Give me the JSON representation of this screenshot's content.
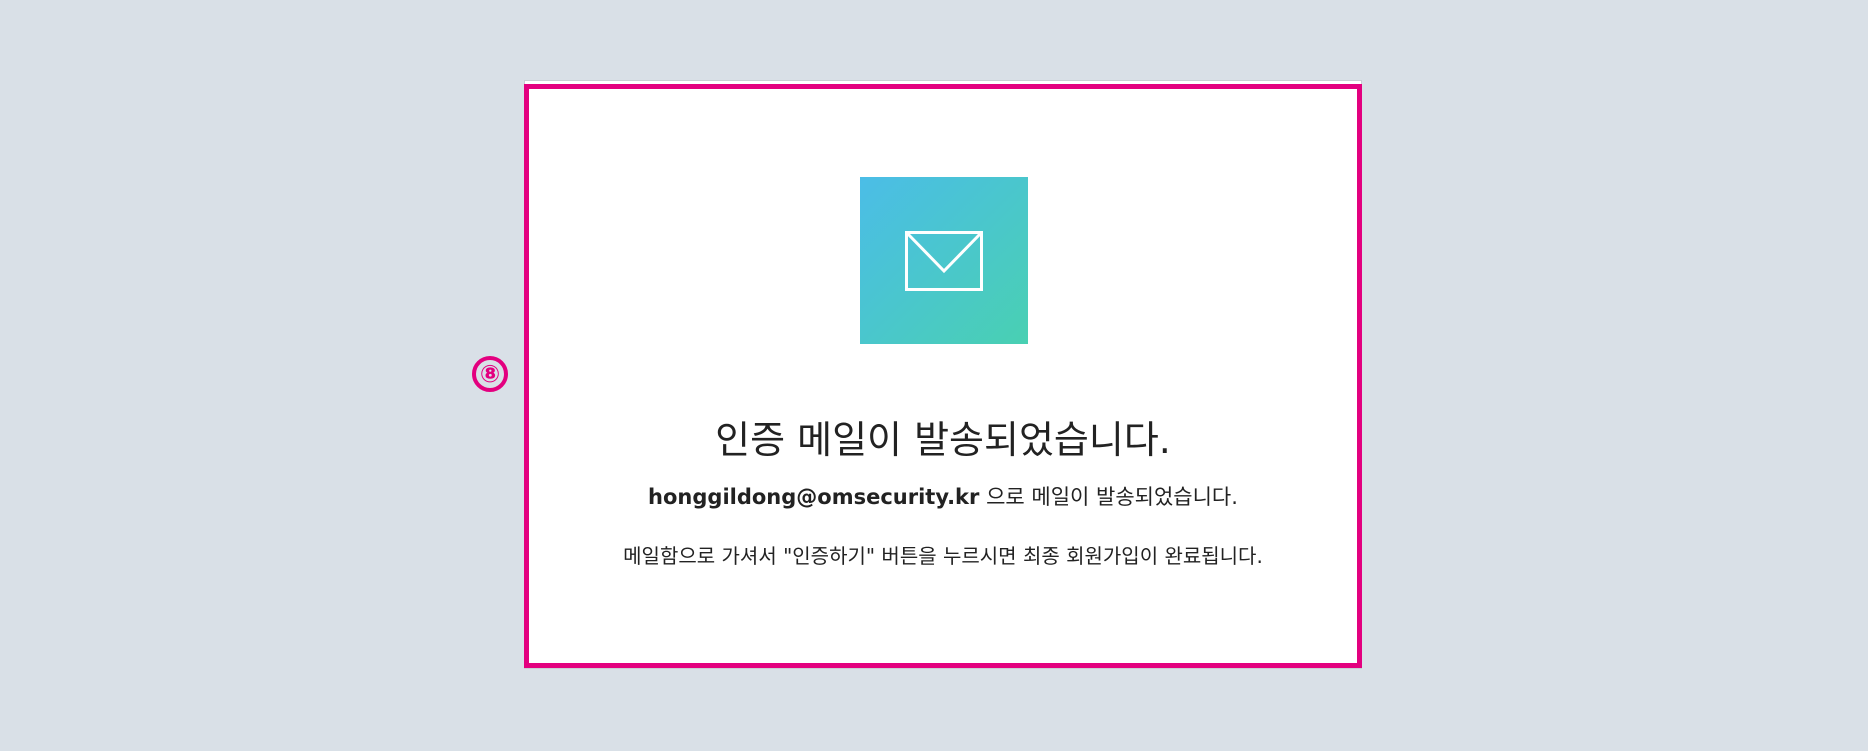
{
  "marker": {
    "label": "⑧"
  },
  "card": {
    "icon": "envelope-icon",
    "title": "인증 메일이 발송되었습니다.",
    "email": "honggildong@omsecurity.kr",
    "email_suffix": " 으로 메일이 발송되었습니다.",
    "instruction": "메일함으로 가셔서 \"인증하기\" 버튼을 누르시면 최종 회원가입이 완료됩니다."
  },
  "colors": {
    "page_background": "#d9e0e7",
    "highlight": "#e3007f",
    "gradient_start": "#4bbde7",
    "gradient_end": "#49d0b2",
    "text": "#222222"
  }
}
